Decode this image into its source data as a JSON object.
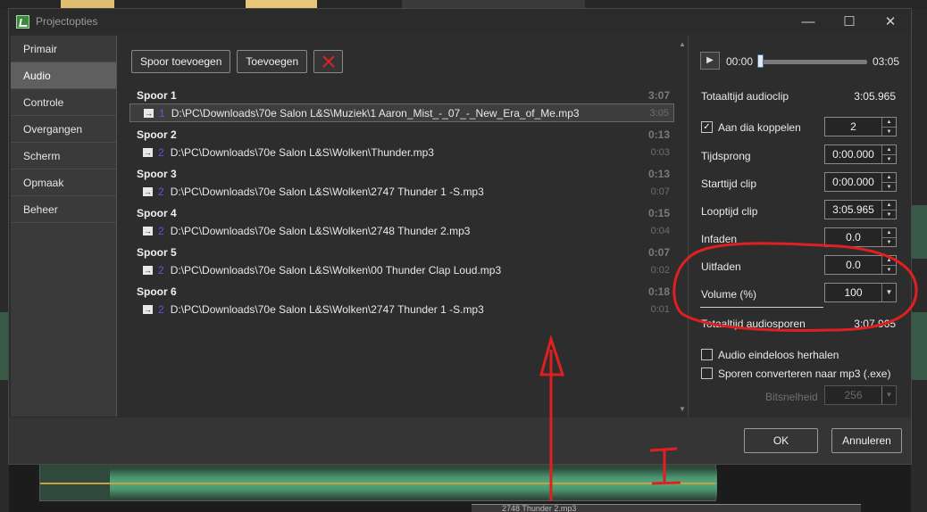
{
  "window": {
    "title": "Projectopties",
    "min_icon": "minimize-icon",
    "max_icon": "maximize-icon",
    "close_icon": "close-icon"
  },
  "sidebar": {
    "items": [
      {
        "label": "Primair"
      },
      {
        "label": "Audio",
        "active": true
      },
      {
        "label": "Controle"
      },
      {
        "label": "Overgangen"
      },
      {
        "label": "Scherm"
      },
      {
        "label": "Opmaak"
      },
      {
        "label": "Beheer"
      }
    ]
  },
  "toolbar": {
    "add_track": "Spoor toevoegen",
    "add": "Toevoegen",
    "delete_icon": "red-x-icon"
  },
  "tracks": [
    {
      "name": "Spoor 1",
      "duration": "3:07",
      "clip": {
        "num": "1",
        "path": "D:\\PC\\Downloads\\70e Salon L&S\\Muziek\\1 Aaron_Mist_-_07_-_New_Era_of_Me.mp3",
        "duration": "3:05",
        "selected": true
      }
    },
    {
      "name": "Spoor 2",
      "duration": "0:13",
      "clip": {
        "num": "2",
        "path": "D:\\PC\\Downloads\\70e Salon L&S\\Wolken\\Thunder.mp3",
        "duration": "0:03"
      }
    },
    {
      "name": "Spoor 3",
      "duration": "0:13",
      "clip": {
        "num": "2",
        "path": "D:\\PC\\Downloads\\70e Salon L&S\\Wolken\\2747 Thunder 1 -S.mp3",
        "duration": "0:07"
      }
    },
    {
      "name": "Spoor 4",
      "duration": "0:15",
      "clip": {
        "num": "2",
        "path": "D:\\PC\\Downloads\\70e Salon L&S\\Wolken\\2748 Thunder 2.mp3",
        "duration": "0:04"
      }
    },
    {
      "name": "Spoor 5",
      "duration": "0:07",
      "clip": {
        "num": "2",
        "path": "D:\\PC\\Downloads\\70e Salon L&S\\Wolken\\00 Thunder Clap Loud.mp3",
        "duration": "0:02"
      }
    },
    {
      "name": "Spoor 6",
      "duration": "0:18",
      "clip": {
        "num": "2",
        "path": "D:\\PC\\Downloads\\70e Salon L&S\\Wolken\\2747 Thunder 1 -S.mp3",
        "duration": "0:01"
      }
    }
  ],
  "player": {
    "time_start": "00:00",
    "time_end": "03:05",
    "position": 0.0
  },
  "props": {
    "total_clip_label": "Totaaltijd audioclip",
    "total_clip_value": "3:05.965",
    "link_label": "Aan dia koppelen",
    "link_checked": true,
    "link_value": "2",
    "jump_label": "Tijdsprong",
    "jump_value": "0:00.000",
    "start_label": "Starttijd clip",
    "start_value": "0:00.000",
    "run_label": "Looptijd clip",
    "run_value": "3:05.965",
    "fadein_label": "Infaden",
    "fadein_value": "0.0",
    "fadeout_label": "Uitfaden",
    "fadeout_value": "0.0",
    "volume_label": "Volume (%)",
    "volume_value": "100",
    "total_tracks_label": "Totaaltijd audiosporen",
    "total_tracks_value": "3:07.965",
    "loop_label": "Audio eindeloos herhalen",
    "convert_label": "Sporen converteren naar mp3 (.exe)",
    "bitrate_label": "Bitsnelheid",
    "bitrate_value": "256"
  },
  "footer": {
    "ok": "OK",
    "cancel": "Annuleren"
  },
  "background": {
    "bottom_clip_label": "2748 Thunder 2.mp3"
  },
  "colors": {
    "accent_red": "#e02020",
    "clip_number": "#5a5ae0"
  }
}
